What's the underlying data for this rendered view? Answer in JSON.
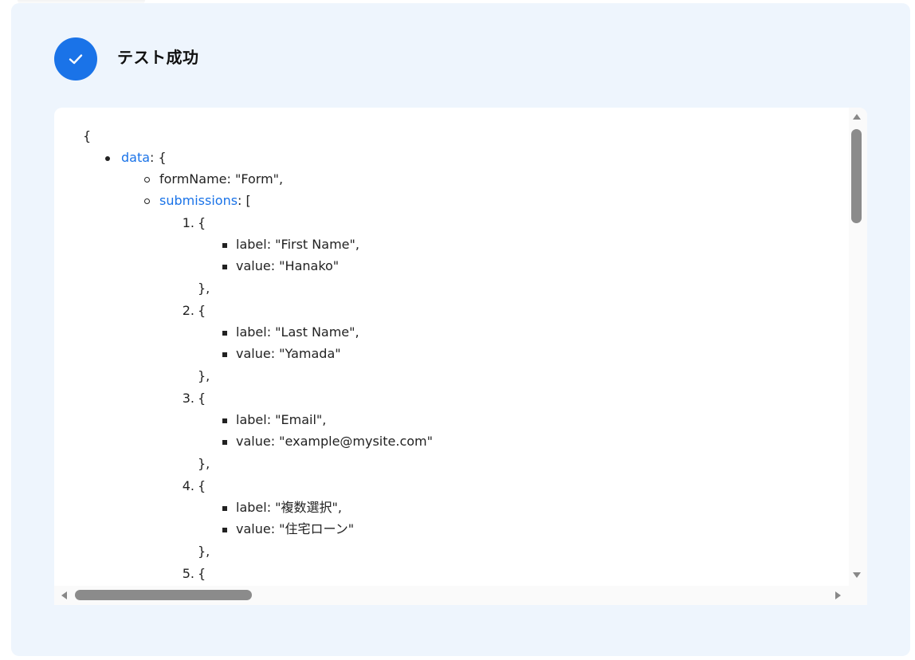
{
  "header": {
    "title": "テスト成功",
    "status_icon": "check-circle-icon",
    "accent_color": "#1a73e8"
  },
  "json_tree": {
    "open_brace": "{",
    "data_key": "data",
    "data_suffix": ": {",
    "form_name_line": "formName: \"Form\",",
    "submissions_key": "submissions",
    "submissions_suffix": ": [",
    "items": [
      {
        "number": "1.",
        "open": "{",
        "label_line": "label: \"First Name\",",
        "value_line": "value: \"Hanako\"",
        "close": "},"
      },
      {
        "number": "2.",
        "open": "{",
        "label_line": "label: \"Last Name\",",
        "value_line": "value: \"Yamada\"",
        "close": "},"
      },
      {
        "number": "3.",
        "open": "{",
        "label_line": "label: \"Email\",",
        "value_line": "value: \"example@mysite.com\"",
        "close": "},"
      },
      {
        "number": "4.",
        "open": "{",
        "label_line": "label: \"複数選択\",",
        "value_line": "value: \"住宅ローン\"",
        "close": "},"
      },
      {
        "number": "5.",
        "open": "{"
      }
    ]
  }
}
